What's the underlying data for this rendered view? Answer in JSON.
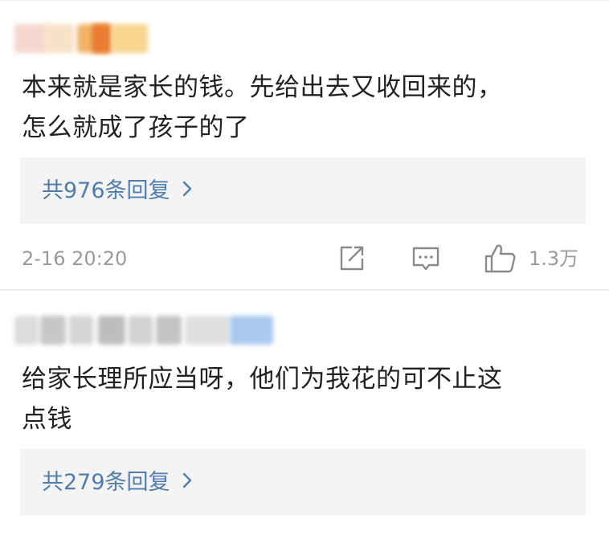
{
  "comments": [
    {
      "text": "本来就是家长的钱。先给出去又收回来的，\n怎么就成了孩子的了",
      "reply_link": "共976条回复",
      "time": "2-16 20:20",
      "like_count": "1.3万"
    },
    {
      "text": "给家长理所应当呀，他们为我花的可不止这\n点钱",
      "reply_link": "共279条回复"
    }
  ],
  "icons": {
    "share": "share-icon",
    "comment": "comment-icon",
    "like": "thumbs-up-icon",
    "chevron": "chevron-right-icon"
  },
  "colors": {
    "link": "#507daf",
    "meta": "#9a9a9a",
    "reply_bg": "#f4f4f4",
    "text": "#222222"
  }
}
